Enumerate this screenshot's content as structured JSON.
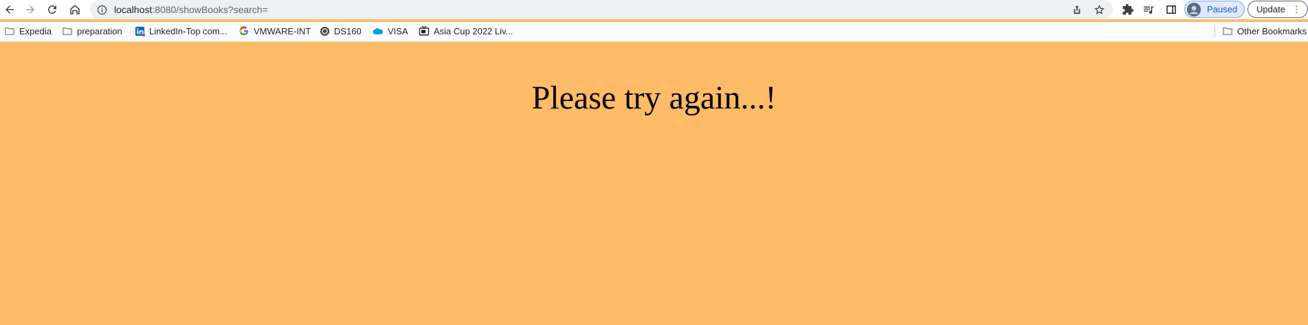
{
  "browser": {
    "url_host": "localhost",
    "url_rest": ":8080/showBooks?search=",
    "profile_label": "Paused",
    "update_label": "Update"
  },
  "bookmarks": [
    {
      "label": "Expedia",
      "icon": "folder-icon"
    },
    {
      "label": "preparation",
      "icon": "folder-icon"
    },
    {
      "label": "LinkedIn-Top com...",
      "icon": "linkedin-icon"
    },
    {
      "label": "VMWARE-INT",
      "icon": "google-icon"
    },
    {
      "label": "DS160",
      "icon": "seal-icon"
    },
    {
      "label": "VISA",
      "icon": "salesforce-cloud-icon"
    },
    {
      "label": "Asia Cup 2022 Liv...",
      "icon": "tv-icon"
    }
  ],
  "other_bookmarks": "Other Bookmarks",
  "page": {
    "message": "Please try again...!",
    "background": "#ffbb67"
  }
}
